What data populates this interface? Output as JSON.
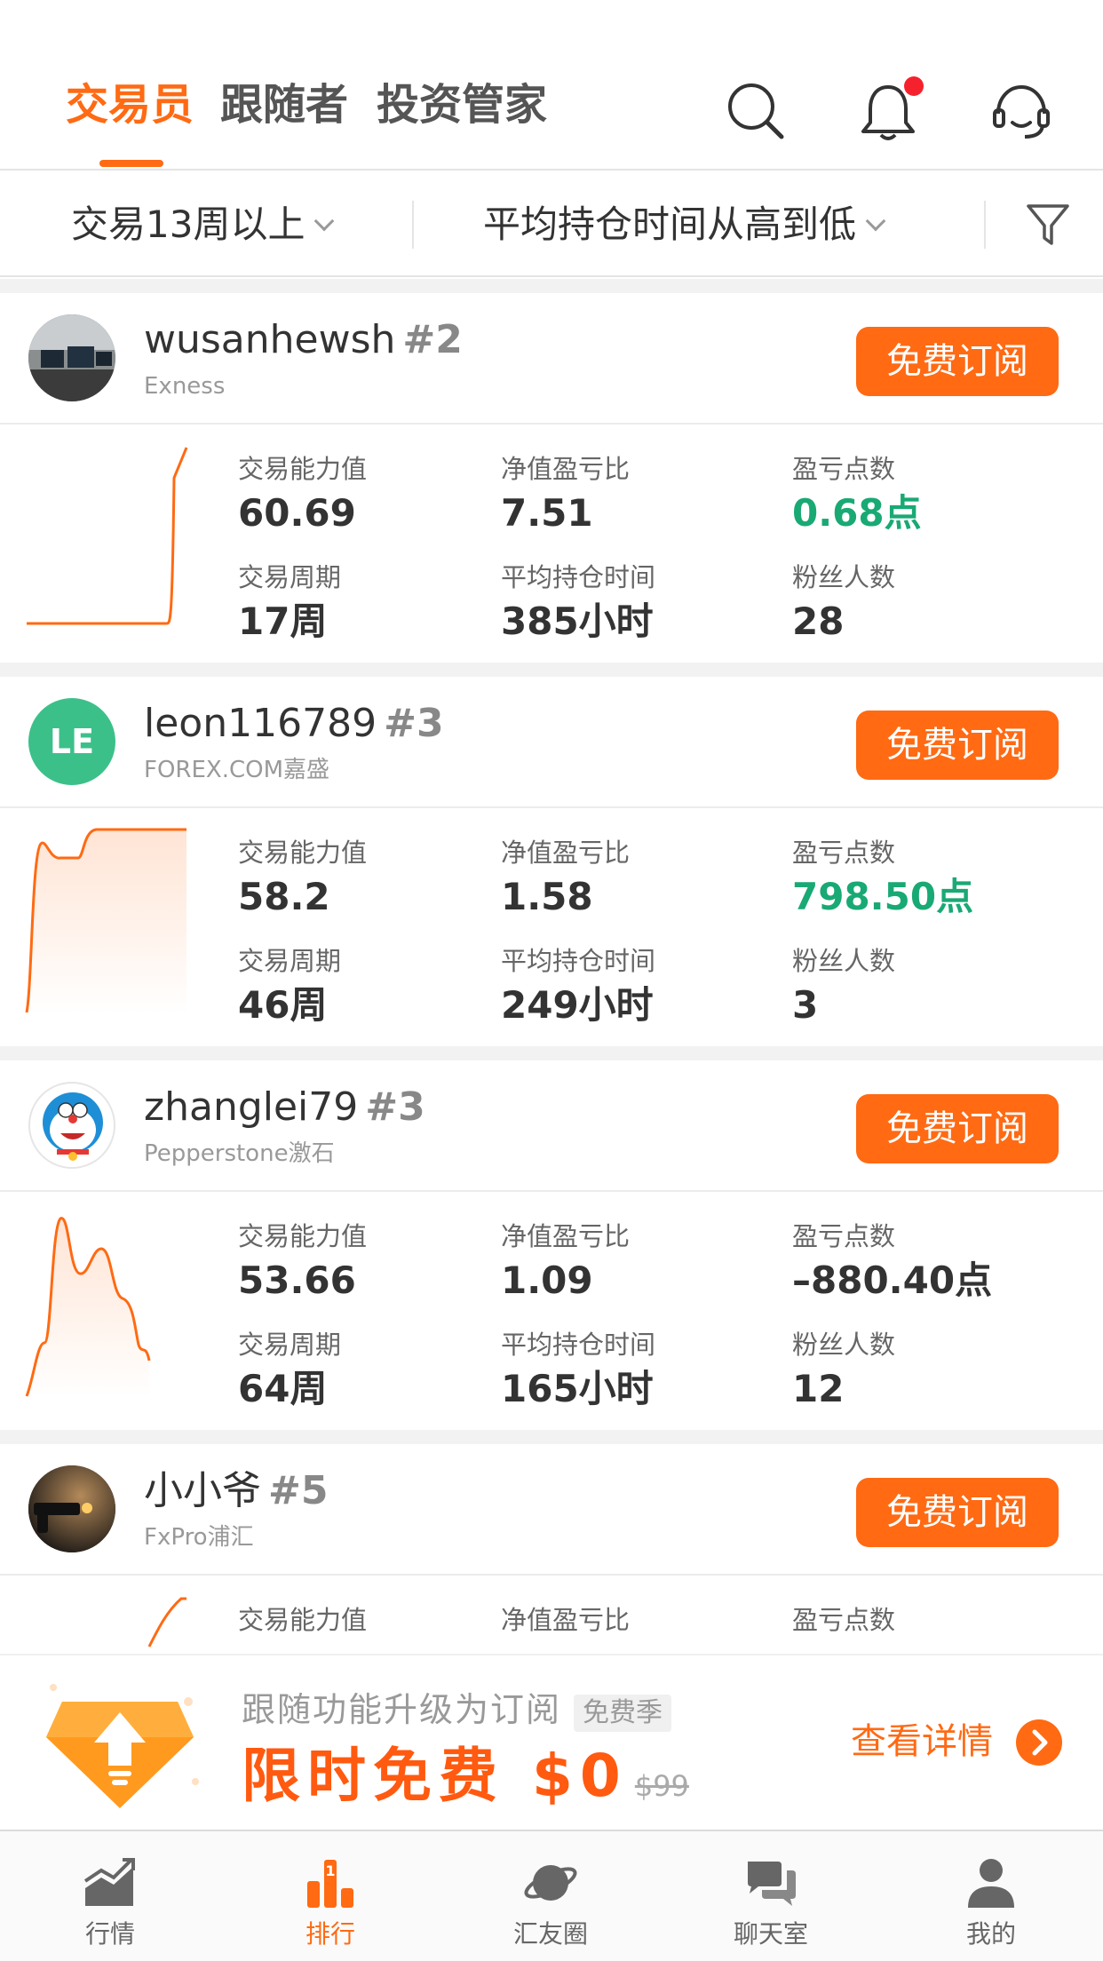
{
  "header": {
    "tabs": [
      {
        "label": "交易员",
        "active": true
      },
      {
        "label": "跟随者",
        "active": false
      },
      {
        "label": "投资管家",
        "active": false
      }
    ],
    "icons": [
      "search-icon",
      "bell-icon",
      "headset-icon"
    ],
    "accent_color": "#ff6a13"
  },
  "filters": {
    "period": "交易13周以上",
    "sort": "平均持仓时间从高到低"
  },
  "labels": {
    "ability": "交易能力值",
    "ratio": "净值盈亏比",
    "points": "盈亏点数",
    "period": "交易周期",
    "avg_hold": "平均持仓时间",
    "fans": "粉丝人数",
    "subscribe": "免费订阅"
  },
  "traders": [
    {
      "name": "wusanhewsh",
      "rank": "#2",
      "broker": "Exness",
      "ability": "60.69",
      "ratio": "7.51",
      "points": "0.68点",
      "points_color": "#19a974",
      "period": "17周",
      "avg_hold": "385小时",
      "fans": "28"
    },
    {
      "name": "leon116789",
      "rank": "#3",
      "broker": "FOREX.COM嘉盛",
      "avatar_text": "LE",
      "ability": "58.2",
      "ratio": "1.58",
      "points": "798.50点",
      "points_color": "#19a974",
      "period": "46周",
      "avg_hold": "249小时",
      "fans": "3"
    },
    {
      "name": "zhanglei79",
      "rank": "#3",
      "broker": "Pepperstone激石",
      "ability": "53.66",
      "ratio": "1.09",
      "points": "–880.40点",
      "points_color": "#333333",
      "period": "64周",
      "avg_hold": "165小时",
      "fans": "12"
    },
    {
      "name": "小小爷",
      "rank": "#5",
      "broker": "FxPro浦汇"
    }
  ],
  "promo": {
    "line1": "跟随功能升级为订阅",
    "badge": "免费季",
    "line2": "限时免费 $0",
    "old_price": "$99",
    "detail": "查看详情"
  },
  "bottom_nav": [
    {
      "label": "行情",
      "icon": "market-chart-icon",
      "active": false
    },
    {
      "label": "排行",
      "icon": "ranking-icon",
      "active": true
    },
    {
      "label": "汇友圈",
      "icon": "planet-icon",
      "active": false
    },
    {
      "label": "聊天室",
      "icon": "chat-icon",
      "active": false
    },
    {
      "label": "我的",
      "icon": "profile-icon",
      "active": false
    }
  ]
}
